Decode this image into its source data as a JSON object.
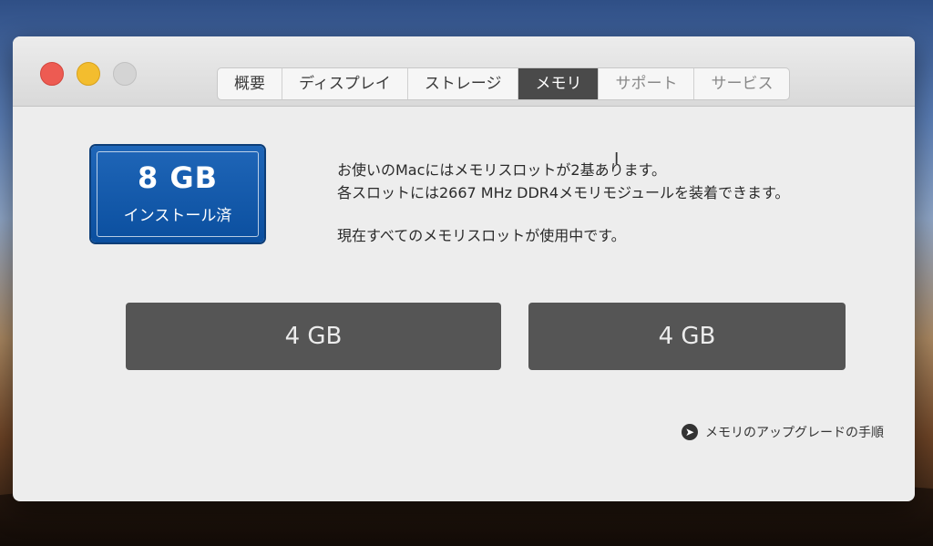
{
  "window": {
    "tabs": [
      {
        "label": "概要"
      },
      {
        "label": "ディスプレイ"
      },
      {
        "label": "ストレージ"
      },
      {
        "label": "メモリ"
      },
      {
        "label": "サポート"
      },
      {
        "label": "サービス"
      }
    ],
    "active_tab": "メモリ"
  },
  "memory": {
    "installed_size": "8 GB",
    "installed_label": "インストール済",
    "info_line1": "お使いのMacにはメモリスロットが2基あります。",
    "info_line2": "各スロットには2667 MHz DDR4メモリモジュールを装着できます。",
    "info_line3": "現在すべてのメモリスロットが使用中です。",
    "slots": [
      {
        "label": "4 GB"
      },
      {
        "label": "4 GB"
      }
    ],
    "upgrade_link": "メモリのアップグレードの手順"
  },
  "colors": {
    "badge": "#0b4f9f",
    "slot": "#555555",
    "active_tab": "#4a4a4a",
    "close": "#ed5b52",
    "minimize": "#f3bd2e"
  },
  "icons": {
    "upgrade_link_icon": "arrow-right-circle-icon",
    "cursor": "text-cursor-icon"
  }
}
